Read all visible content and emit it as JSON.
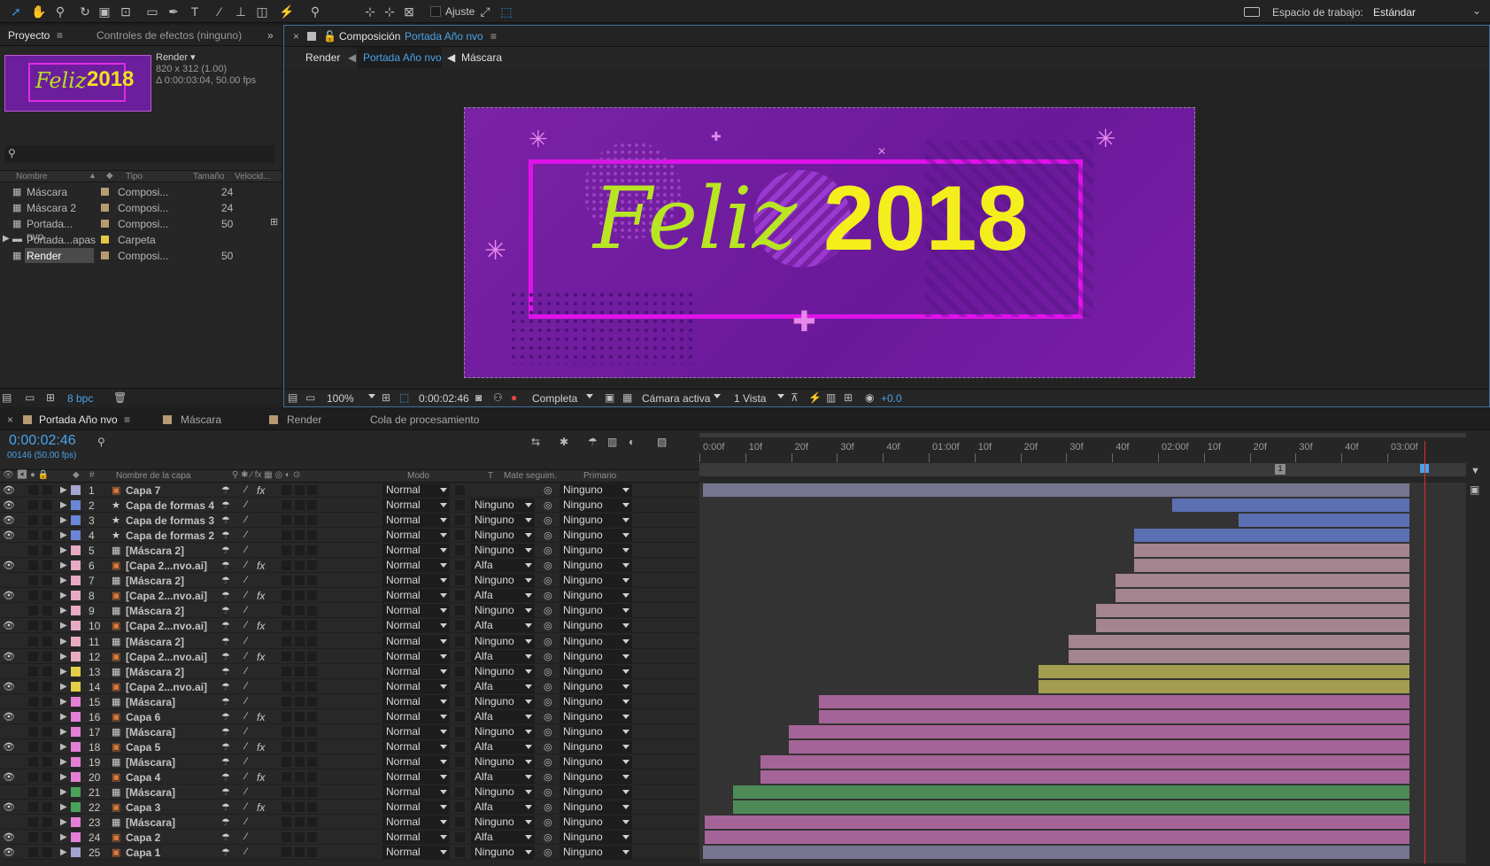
{
  "toolbar": {
    "snap_label": "Ajuste",
    "workspace_label": "Espacio de trabajo:",
    "workspace_value": "Estándar"
  },
  "project": {
    "tab_project": "Proyecto",
    "tab_effects": "Controles de efectos (ninguno)",
    "info": {
      "name": "Render ▾",
      "dims": "820 x 312 (1.00)",
      "duration": "Δ 0:00:03:04, 50.00 fps"
    },
    "thumb": {
      "text1": "Feliz",
      "text2": "2018"
    },
    "cols": {
      "name": "Nombre",
      "type": "Tipo",
      "size": "Tamaño",
      "speed": "Velocid..."
    },
    "items": [
      {
        "name": "Máscara",
        "type": "Composi...",
        "size": "24",
        "color": "#b79a73"
      },
      {
        "name": "Máscara 2",
        "type": "Composi...",
        "size": "24",
        "color": "#b79a73"
      },
      {
        "name": "Portada... nvo",
        "type": "Composi...",
        "size": "50",
        "color": "#b79a73"
      },
      {
        "name": "Portada...apas",
        "type": "Carpeta",
        "size": "",
        "color": "#e3c948"
      },
      {
        "name": "Render",
        "type": "Composi...",
        "size": "50",
        "color": "#b79a73"
      }
    ],
    "bpc": "8 bpc"
  },
  "comp": {
    "title_prefix": "Composición",
    "title_name": "Portada Año nvo",
    "crumbs": [
      "Render",
      "Portada Año nvo",
      "Máscara"
    ],
    "canvas": {
      "word": "Feliz",
      "year": "2018"
    },
    "bar": {
      "zoom": "100%",
      "time": "0:00:02:46",
      "quality": "Completa",
      "camera": "Cámara activa",
      "views": "1 Vista",
      "exposure": "+0.0"
    }
  },
  "timeline": {
    "tabs": [
      "Portada Año nvo",
      "Máscara",
      "Render",
      "Cola de procesamiento"
    ],
    "time": "0:00:02:46",
    "frames": "00146 (50.00 fps)",
    "cols": {
      "layer_name": "Nombre de la capa",
      "mode": "Modo",
      "t": "T",
      "matte": "Mate seguim.",
      "parent": "Primario"
    },
    "ruler": [
      "0:00f",
      "10f",
      "20f",
      "30f",
      "40f",
      "01:00f",
      "10f",
      "20f",
      "30f",
      "40f",
      "02:00f",
      "10f",
      "20f",
      "30f",
      "40f",
      "03:00f"
    ],
    "marker": "1",
    "layers": [
      {
        "n": "1",
        "name": "Capa 7",
        "mode": "Normal",
        "matte": "",
        "parent": "Ninguno",
        "color": "#a4a4cf",
        "bar": "#767691",
        "start": 0.0,
        "fx": true,
        "eye": true,
        "src": "ai"
      },
      {
        "n": "2",
        "name": "Capa de formas 4",
        "mode": "Normal",
        "matte": "Ninguno",
        "parent": "Ninguno",
        "color": "#6b86d6",
        "bar": "#5b6fb3",
        "start": 0.664,
        "fx": false,
        "eye": true,
        "src": "shape"
      },
      {
        "n": "3",
        "name": "Capa de formas 3",
        "mode": "Normal",
        "matte": "Ninguno",
        "parent": "Ninguno",
        "color": "#6b86d6",
        "bar": "#5b6fb3",
        "start": 0.758,
        "fx": false,
        "eye": true,
        "src": "shape"
      },
      {
        "n": "4",
        "name": "Capa de formas 2",
        "mode": "Normal",
        "matte": "Ninguno",
        "parent": "Ninguno",
        "color": "#6b86d6",
        "bar": "#5b6fb3",
        "start": 0.61,
        "fx": false,
        "eye": true,
        "src": "shape"
      },
      {
        "n": "5",
        "name": "[Máscara 2]",
        "mode": "Normal",
        "matte": "Ninguno",
        "parent": "Ninguno",
        "color": "#e8aac3",
        "bar": "#a3848f",
        "start": 0.61,
        "fx": false,
        "eye": false,
        "src": "comp"
      },
      {
        "n": "6",
        "name": "[Capa 2...nvo.ai]",
        "mode": "Normal",
        "matte": "Alfa",
        "parent": "Ninguno",
        "color": "#e8aac3",
        "bar": "#a3848f",
        "start": 0.61,
        "fx": true,
        "eye": true,
        "src": "ai"
      },
      {
        "n": "7",
        "name": "[Máscara 2]",
        "mode": "Normal",
        "matte": "Ninguno",
        "parent": "Ninguno",
        "color": "#e8aac3",
        "bar": "#a3848f",
        "start": 0.584,
        "fx": false,
        "eye": false,
        "src": "comp"
      },
      {
        "n": "8",
        "name": "[Capa 2...nvo.ai]",
        "mode": "Normal",
        "matte": "Alfa",
        "parent": "Ninguno",
        "color": "#e8aac3",
        "bar": "#a3848f",
        "start": 0.584,
        "fx": true,
        "eye": true,
        "src": "ai"
      },
      {
        "n": "9",
        "name": "[Máscara 2]",
        "mode": "Normal",
        "matte": "Ninguno",
        "parent": "Ninguno",
        "color": "#e8aac3",
        "bar": "#a3848f",
        "start": 0.557,
        "fx": false,
        "eye": false,
        "src": "comp"
      },
      {
        "n": "10",
        "name": "[Capa 2...nvo.ai]",
        "mode": "Normal",
        "matte": "Alfa",
        "parent": "Ninguno",
        "color": "#e8aac3",
        "bar": "#a3848f",
        "start": 0.557,
        "fx": true,
        "eye": true,
        "src": "ai"
      },
      {
        "n": "11",
        "name": "[Máscara 2]",
        "mode": "Normal",
        "matte": "Ninguno",
        "parent": "Ninguno",
        "color": "#e8aac3",
        "bar": "#a3848f",
        "start": 0.517,
        "fx": false,
        "eye": false,
        "src": "comp"
      },
      {
        "n": "12",
        "name": "[Capa 2...nvo.ai]",
        "mode": "Normal",
        "matte": "Alfa",
        "parent": "Ninguno",
        "color": "#e8aac3",
        "bar": "#a3848f",
        "start": 0.517,
        "fx": true,
        "eye": true,
        "src": "ai"
      },
      {
        "n": "13",
        "name": "[Máscara 2]",
        "mode": "Normal",
        "matte": "Ninguno",
        "parent": "Ninguno",
        "color": "#e3cf49",
        "bar": "#a39d50",
        "start": 0.475,
        "fx": false,
        "eye": false,
        "src": "comp"
      },
      {
        "n": "14",
        "name": "[Capa 2...nvo.ai]",
        "mode": "Normal",
        "matte": "Alfa",
        "parent": "Ninguno",
        "color": "#e3cf49",
        "bar": "#a39d50",
        "start": 0.475,
        "fx": false,
        "eye": true,
        "src": "ai"
      },
      {
        "n": "15",
        "name": "[Máscara]",
        "mode": "Normal",
        "matte": "Ninguno",
        "parent": "Ninguno",
        "color": "#e47fd6",
        "bar": "#a56497",
        "start": 0.164,
        "fx": false,
        "eye": false,
        "src": "comp"
      },
      {
        "n": "16",
        "name": "Capa 6",
        "mode": "Normal",
        "matte": "Alfa",
        "parent": "Ninguno",
        "color": "#e47fd6",
        "bar": "#a56497",
        "start": 0.164,
        "fx": true,
        "eye": true,
        "src": "ai"
      },
      {
        "n": "17",
        "name": "[Máscara]",
        "mode": "Normal",
        "matte": "Ninguno",
        "parent": "Ninguno",
        "color": "#e47fd6",
        "bar": "#a56497",
        "start": 0.122,
        "fx": false,
        "eye": false,
        "src": "comp"
      },
      {
        "n": "18",
        "name": "Capa 5",
        "mode": "Normal",
        "matte": "Alfa",
        "parent": "Ninguno",
        "color": "#e47fd6",
        "bar": "#a56497",
        "start": 0.122,
        "fx": true,
        "eye": true,
        "src": "ai"
      },
      {
        "n": "19",
        "name": "[Máscara]",
        "mode": "Normal",
        "matte": "Ninguno",
        "parent": "Ninguno",
        "color": "#e47fd6",
        "bar": "#a56497",
        "start": 0.082,
        "fx": false,
        "eye": false,
        "src": "comp"
      },
      {
        "n": "20",
        "name": "Capa 4",
        "mode": "Normal",
        "matte": "Alfa",
        "parent": "Ninguno",
        "color": "#e47fd6",
        "bar": "#a56497",
        "start": 0.082,
        "fx": true,
        "eye": true,
        "src": "ai"
      },
      {
        "n": "21",
        "name": "[Máscara]",
        "mode": "Normal",
        "matte": "Ninguno",
        "parent": "Ninguno",
        "color": "#49a35b",
        "bar": "#4d8a57",
        "start": 0.042,
        "fx": false,
        "eye": false,
        "src": "comp"
      },
      {
        "n": "22",
        "name": "Capa 3",
        "mode": "Normal",
        "matte": "Alfa",
        "parent": "Ninguno",
        "color": "#49a35b",
        "bar": "#4d8a57",
        "start": 0.042,
        "fx": true,
        "eye": true,
        "src": "ai"
      },
      {
        "n": "23",
        "name": "[Máscara]",
        "mode": "Normal",
        "matte": "Ninguno",
        "parent": "Ninguno",
        "color": "#e47fd6",
        "bar": "#a56497",
        "start": 0.002,
        "fx": false,
        "eye": false,
        "src": "comp"
      },
      {
        "n": "24",
        "name": "Capa 2",
        "mode": "Normal",
        "matte": "Alfa",
        "parent": "Ninguno",
        "color": "#e47fd6",
        "bar": "#a56497",
        "start": 0.002,
        "fx": false,
        "eye": true,
        "src": "ai"
      },
      {
        "n": "25",
        "name": "Capa 1",
        "mode": "Normal",
        "matte": "Ninguno",
        "parent": "Ninguno",
        "color": "#a4a4cf",
        "bar": "#767691",
        "start": 0.0,
        "fx": false,
        "eye": true,
        "src": "ai"
      }
    ]
  }
}
